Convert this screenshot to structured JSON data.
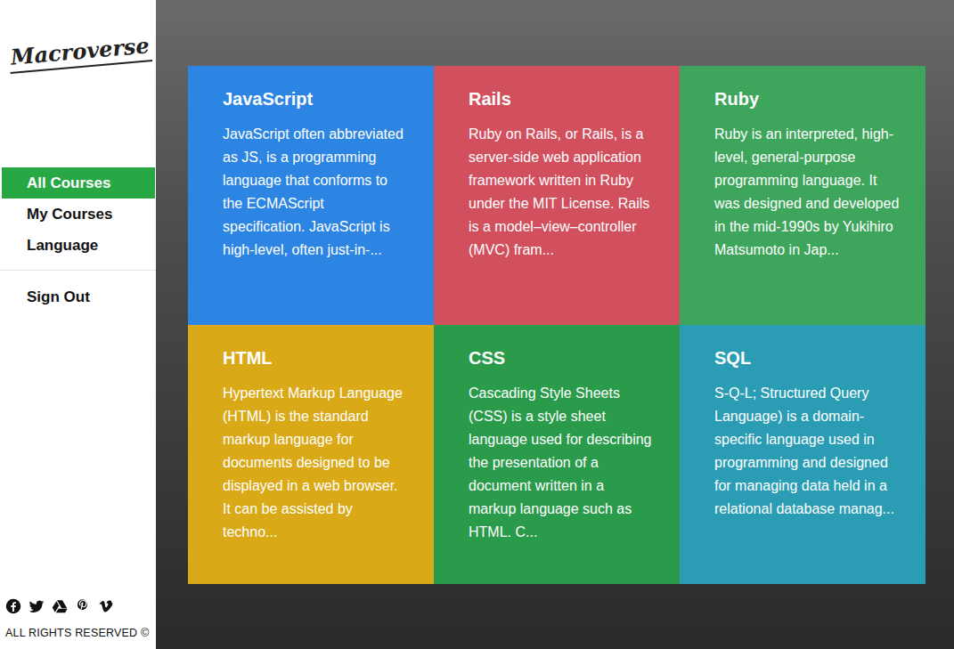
{
  "logo": "Macroverse",
  "sidebar": {
    "items": [
      {
        "label": "All Courses",
        "selected": true
      },
      {
        "label": "My Courses",
        "selected": false
      },
      {
        "label": "Language",
        "selected": false
      }
    ],
    "sign_out": "Sign Out"
  },
  "footer": {
    "copyright": "ALL RIGHTS RESERVED ©"
  },
  "courses": [
    {
      "title": "JavaScript",
      "description": "JavaScript often abbreviated as JS, is a programming language that conforms to the ECMAScript specification. JavaScript is high-level, often just-in-...",
      "color": "#2c85e2"
    },
    {
      "title": "Rails",
      "description": "Ruby on Rails, or Rails, is a server-side web application framework written in Ruby under the MIT License. Rails is a model–view–controller (MVC) fram...",
      "color": "#d24f5e"
    },
    {
      "title": "Ruby",
      "description": "Ruby is an interpreted, high-level, general-purpose programming language. It was designed and developed in the mid-1990s by Yukihiro Matsumoto in Jap...",
      "color": "#3ea55c"
    },
    {
      "title": "HTML",
      "description": "Hypertext Markup Language (HTML) is the standard markup language for documents designed to be displayed in a web browser. It can be assisted by techno...",
      "color": "#d9a918"
    },
    {
      "title": "CSS",
      "description": "Cascading Style Sheets (CSS) is a style sheet language used for describing the presentation of a document written in a markup language such as HTML. C...",
      "color": "#2a9b4b"
    },
    {
      "title": "SQL",
      "description": "S-Q-L; Structured Query Language) is a domain-specific language used in programming and designed for managing data held in a relational database manag...",
      "color": "#2a9db4"
    }
  ]
}
